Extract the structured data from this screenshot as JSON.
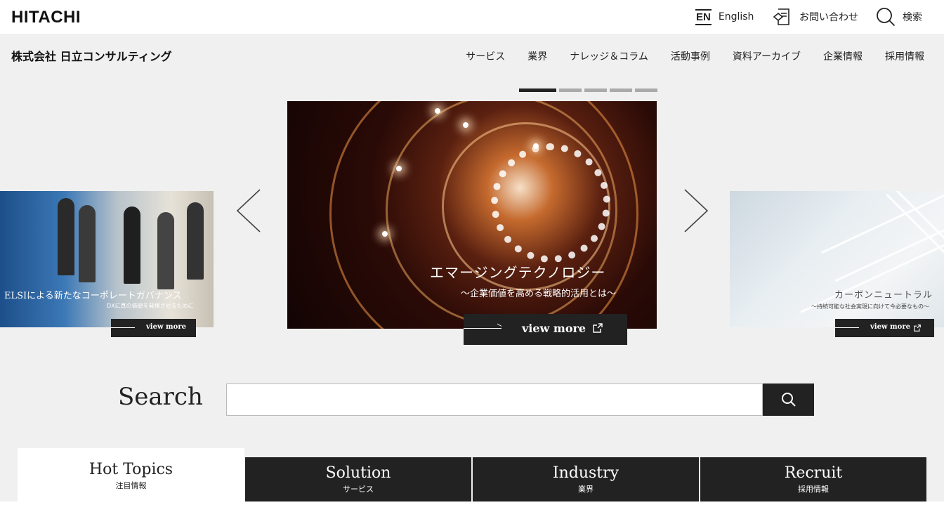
{
  "header": {
    "logo": "HITACHI",
    "lang_badge": "EN",
    "lang_label": "English",
    "contact_label": "お問い合わせ",
    "search_label": "検索"
  },
  "nav": {
    "company": "株式会社 日立コンサルティング",
    "items": [
      "サービス",
      "業界",
      "ナレッジ＆コラム",
      "活動事例",
      "資料アーカイブ",
      "企業情報",
      "採用情報"
    ]
  },
  "carousel": {
    "slide_count": 5,
    "active_index": 0,
    "main": {
      "title": "エマージングテクノロジー",
      "subtitle": "〜企業価値を高める戦略的活用とは〜",
      "button": "view more"
    },
    "left": {
      "title": "ELSIによる新たなコーポレートガバナンス",
      "subtitle": "DXに真の価値を発揮させるために",
      "button": "view more"
    },
    "right": {
      "title": "カーボンニュートラル",
      "subtitle": "〜持続可能な社会実現に向けて今必要なもの〜",
      "button": "view more"
    }
  },
  "search": {
    "label": "Search",
    "placeholder": ""
  },
  "tabs": [
    {
      "title": "Hot Topics",
      "sub": "注目情報"
    },
    {
      "title": "Solution",
      "sub": "サービス"
    },
    {
      "title": "Industry",
      "sub": "業界"
    },
    {
      "title": "Recruit",
      "sub": "採用情報"
    }
  ]
}
